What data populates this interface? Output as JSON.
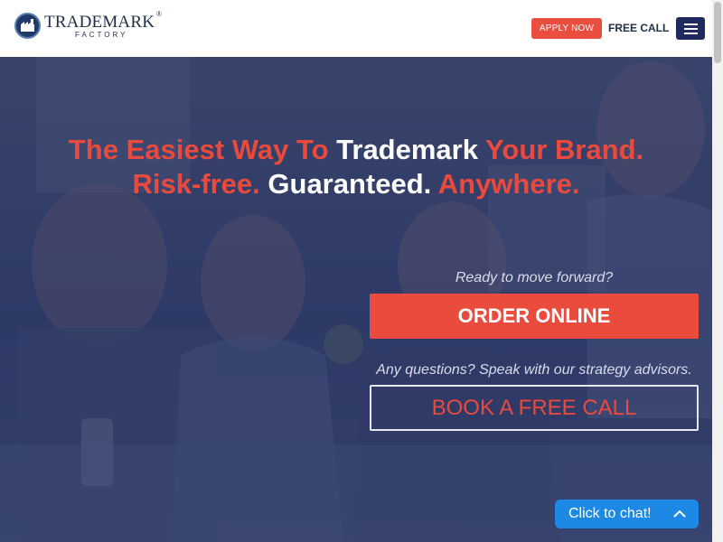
{
  "header": {
    "logo_name": "TRADEMARK",
    "logo_reg": "®",
    "logo_sub": "FACTORY",
    "apply_label": "APPLY NOW",
    "free_call_label": "FREE CALL",
    "menu_icon": "hamburger-menu-icon"
  },
  "hero": {
    "headline_line1": {
      "part1": "The Easiest Way To ",
      "part2": "Trademark",
      "part3": " Your Brand."
    },
    "headline_line2": {
      "part1": "Risk-free.",
      "part2": " Guaranteed.",
      "part3": " Anywhere."
    },
    "ready_text": "Ready to move forward?",
    "order_label": "ORDER ONLINE",
    "questions_text": "Any questions? Speak with our strategy advisors.",
    "book_label": "BOOK A FREE CALL"
  },
  "chat": {
    "label": "Click to chat!",
    "icon": "chevron-up-icon"
  },
  "colors": {
    "accent_red": "#e94b3c",
    "navy": "#1f2a5e",
    "chat_blue": "#1e88e5",
    "overlay": "#222e5c"
  }
}
